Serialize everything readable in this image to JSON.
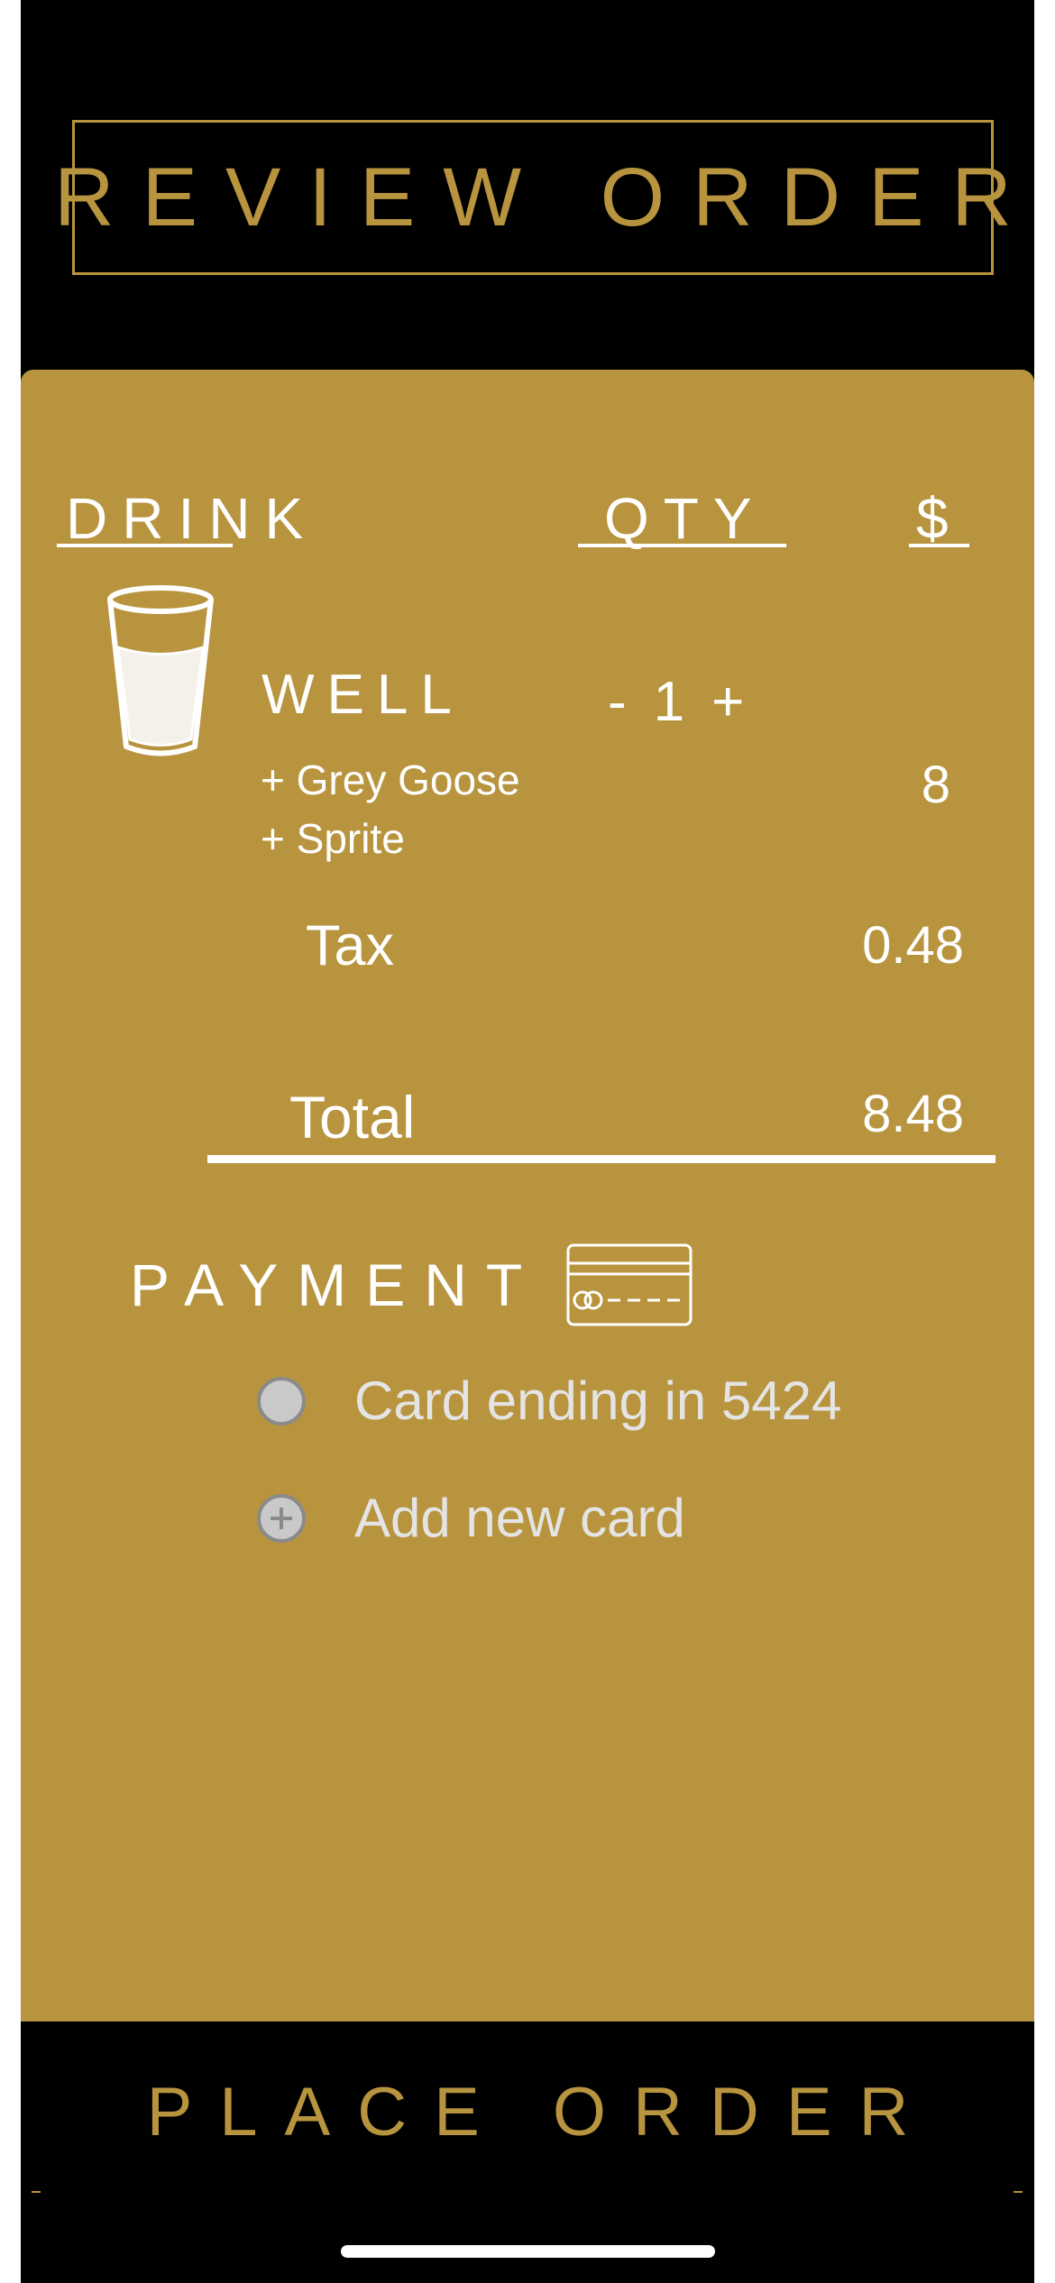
{
  "header": {
    "title": "REVIEW ORDER"
  },
  "columns": {
    "drink": "DRINK",
    "qty": "QTY",
    "price": "$"
  },
  "item": {
    "icon": "glass-icon",
    "name": "WELL",
    "qty_minus": "-",
    "qty": "1",
    "qty_plus": "+",
    "modifiers": [
      "+ Grey Goose",
      "+ Sprite"
    ],
    "price": "8"
  },
  "tax": {
    "label": "Tax",
    "value": "0.48"
  },
  "total": {
    "label": "Total",
    "value": "8.48"
  },
  "payment": {
    "title": "PAYMENT",
    "icon": "credit-card-icon",
    "options": [
      {
        "label": "Card ending in 5424",
        "icon": "radio-icon"
      },
      {
        "label": "Add new card",
        "icon": "plus-circle-icon"
      }
    ]
  },
  "footer": {
    "place_order": "PLACE ORDER"
  },
  "colors": {
    "gold": "#b8943f",
    "background": "#000000",
    "text": "#ffffff",
    "muted": "#c9c9c9"
  }
}
